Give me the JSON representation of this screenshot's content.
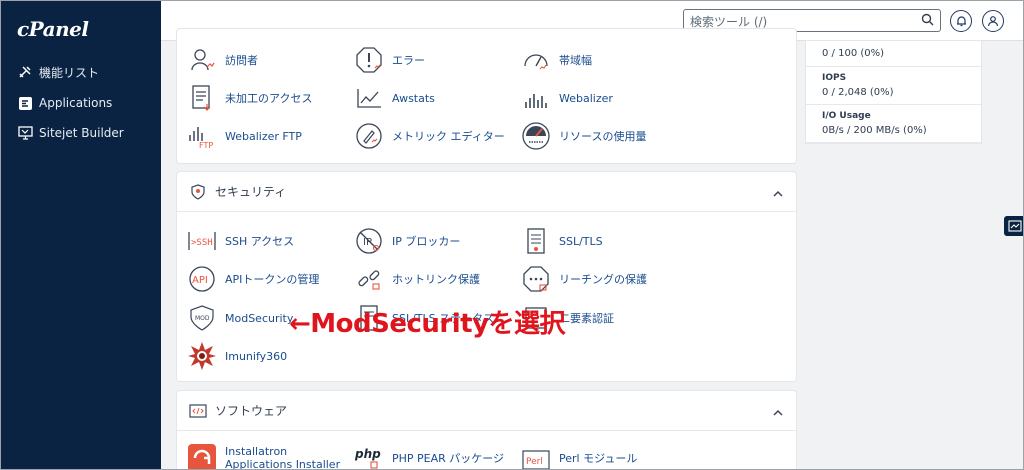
{
  "sidebar": {
    "logo": "cPanel",
    "items": [
      {
        "label": "機能リスト",
        "icon": "tools-icon"
      },
      {
        "label": "Applications",
        "icon": "applications-icon"
      },
      {
        "label": "Sitejet Builder",
        "icon": "sitejet-icon"
      }
    ]
  },
  "header": {
    "search_placeholder": "検索ツール (/)",
    "icons": [
      "search-icon",
      "bell-icon",
      "user-icon"
    ]
  },
  "metrics": {
    "items": [
      {
        "label": "訪問者",
        "icon": "visitors-icon"
      },
      {
        "label": "エラー",
        "icon": "errors-icon"
      },
      {
        "label": "帯域幅",
        "icon": "bandwidth-icon"
      },
      {
        "label": "未加工のアクセス",
        "icon": "raw-access-icon"
      },
      {
        "label": "Awstats",
        "icon": "awstats-icon"
      },
      {
        "label": "Webalizer",
        "icon": "webalizer-icon"
      },
      {
        "label": "Webalizer FTP",
        "icon": "webalizer-ftp-icon"
      },
      {
        "label": "メトリック エディター",
        "icon": "metrics-editor-icon"
      },
      {
        "label": "リソースの使用量",
        "icon": "resource-usage-icon"
      }
    ]
  },
  "security": {
    "title": "セキュリティ",
    "items": [
      {
        "label": "SSH アクセス",
        "icon": "ssh-icon"
      },
      {
        "label": "IP ブロッカー",
        "icon": "ip-blocker-icon"
      },
      {
        "label": "SSL/TLS",
        "icon": "ssl-tls-icon"
      },
      {
        "label": "APIトークンの管理",
        "icon": "api-icon"
      },
      {
        "label": "ホットリンク保護",
        "icon": "hotlink-icon"
      },
      {
        "label": "リーチングの保護",
        "icon": "leech-icon"
      },
      {
        "label": "ModSecurity",
        "icon": "modsecurity-icon"
      },
      {
        "label": "SSL/TLS ステータス",
        "icon": "ssl-status-icon"
      },
      {
        "label": "二要素認証",
        "icon": "two-factor-icon"
      },
      {
        "label": "Imunify360",
        "icon": "imunify-icon"
      }
    ]
  },
  "software": {
    "title": "ソフトウェア",
    "items": [
      {
        "label": "Installatron Applications Installer",
        "icon": "installatron-icon"
      },
      {
        "label": "PHP PEAR パッケージ",
        "icon": "php-pear-icon"
      },
      {
        "label": "Perl モジュール",
        "icon": "perl-icon"
      }
    ]
  },
  "stats": [
    {
      "title": "",
      "value": "0 / 100   (0%)"
    },
    {
      "title": "IOPS",
      "value": "0 / 2,048   (0%)"
    },
    {
      "title": "I/O Usage",
      "value": "0B/s / 200 MB/s   (0%)"
    }
  ],
  "annotation": "←ModSecurityを選択",
  "colors": {
    "sidebar": "#0a2342",
    "link": "#1a4c8f",
    "annotation": "#e0141c",
    "accent": "#e8553d"
  }
}
